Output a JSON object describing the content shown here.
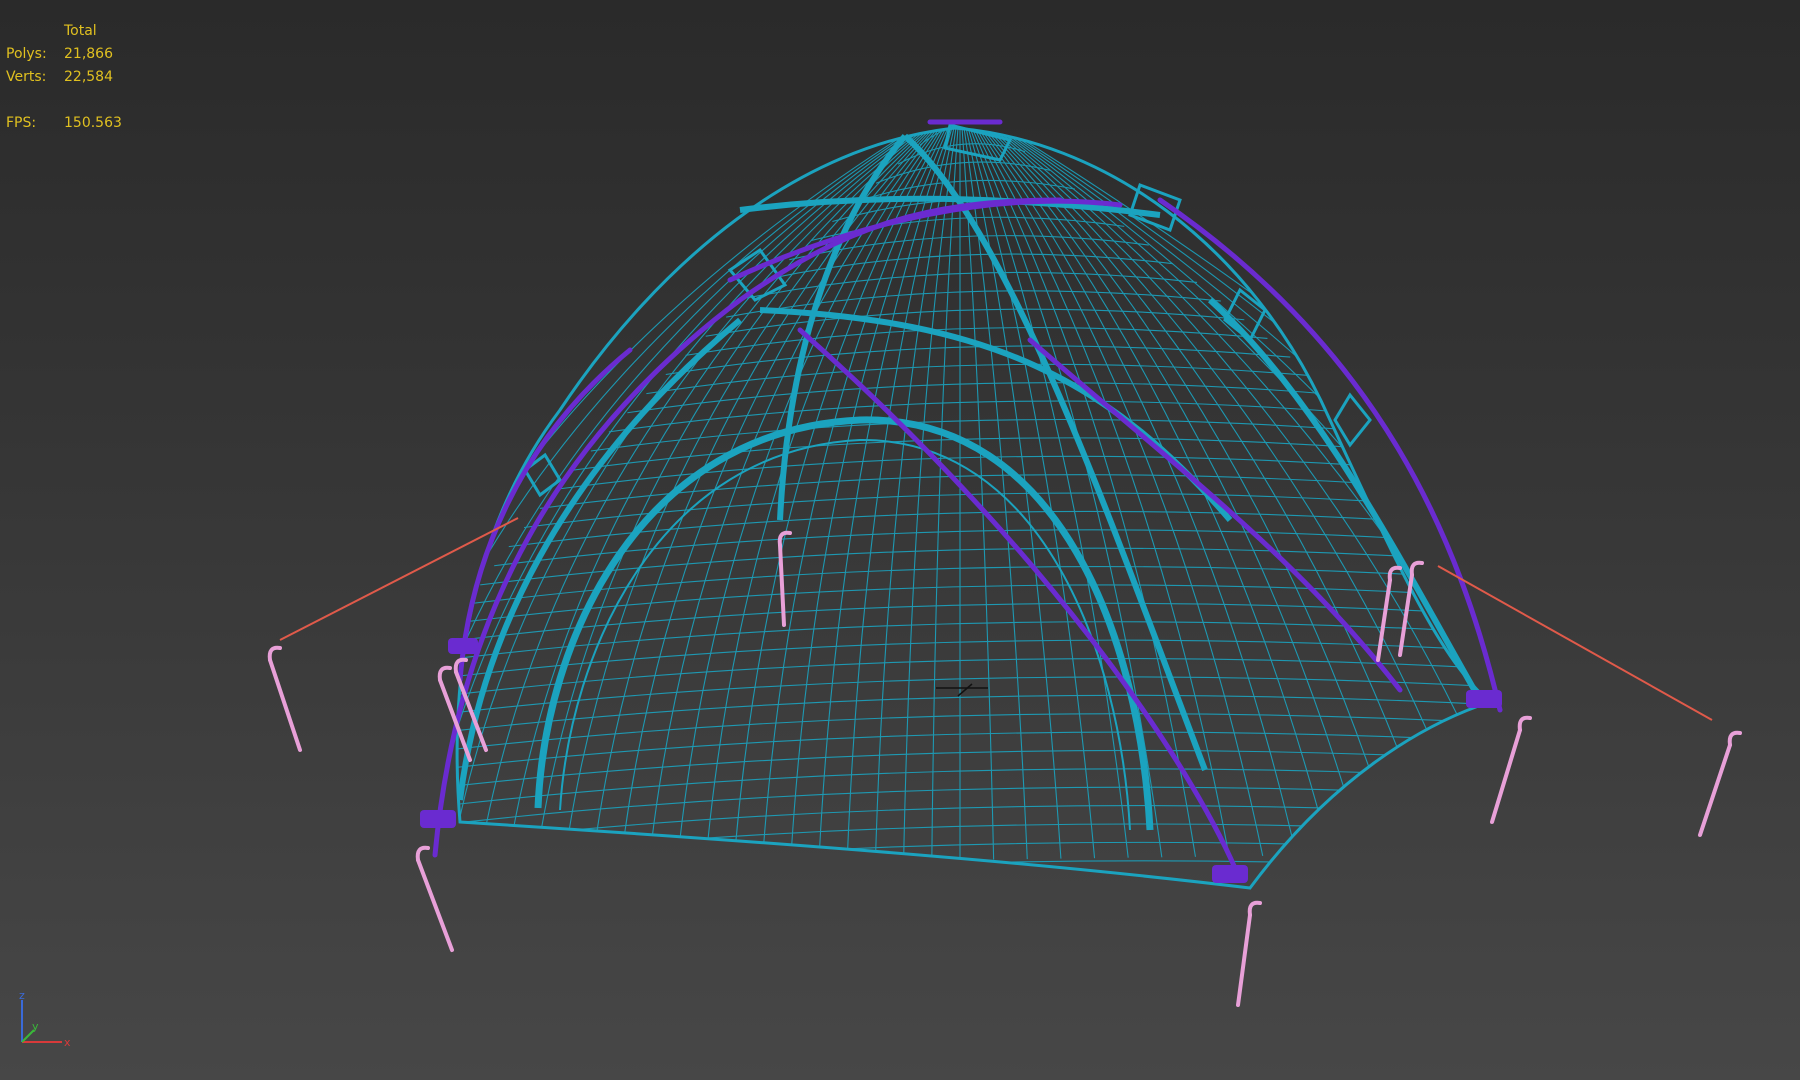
{
  "viewport": {
    "background": "#3a3a3a",
    "object": "dome-tent-wireframe",
    "colors": {
      "mesh": "#1ba3bf",
      "frame_poles": "#6a2bd0",
      "stakes": "#e8a0d8",
      "guy_lines": "#e05a4a",
      "stats_text": "#e0c020"
    }
  },
  "stats": {
    "header": "Total",
    "polys_label": "Polys:",
    "polys_value": "21,866",
    "verts_label": "Verts:",
    "verts_value": "22,584",
    "fps_label": "FPS:",
    "fps_value": "150.563"
  },
  "axis_gizmo": {
    "z": "z",
    "y": "y",
    "x": "x"
  }
}
